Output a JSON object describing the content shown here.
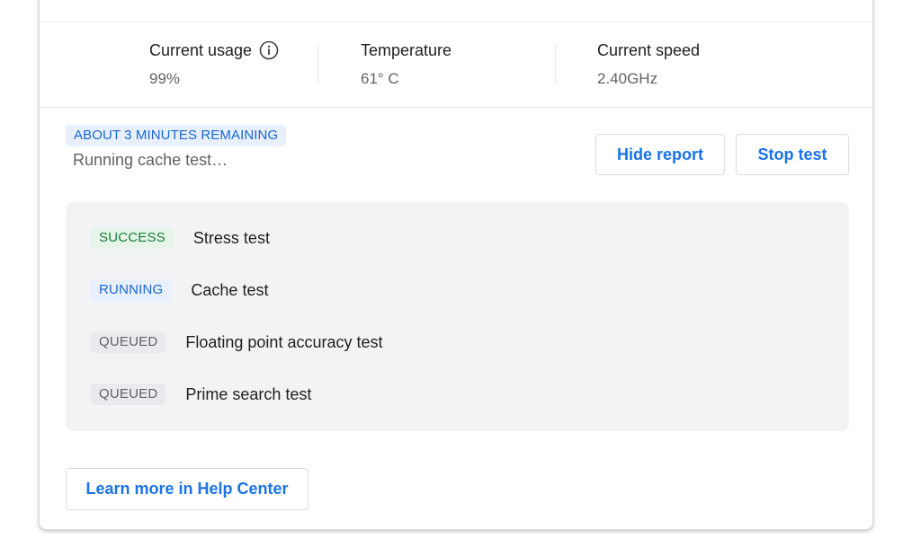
{
  "stats": [
    {
      "label": "Current usage",
      "value": "99%"
    },
    {
      "label": "Temperature",
      "value": "61° C"
    },
    {
      "label": "Current speed",
      "value": "2.40GHz"
    }
  ],
  "status": {
    "remaining": "ABOUT 3 MINUTES REMAINING",
    "message": "Running cache test…"
  },
  "buttons": {
    "hide_report": "Hide report",
    "stop_test": "Stop test",
    "learn_more": "Learn more in Help Center"
  },
  "tests": [
    {
      "status": "SUCCESS",
      "name": "Stress test"
    },
    {
      "status": "RUNNING",
      "name": "Cache test"
    },
    {
      "status": "QUEUED",
      "name": "Floating point accuracy test"
    },
    {
      "status": "QUEUED",
      "name": "Prime search test"
    }
  ],
  "colors": {
    "accent": "#1a73e8",
    "success_bg": "#e6f4ea",
    "success_fg": "#188038",
    "running_bg": "#e8f0fe",
    "running_fg": "#1967d2",
    "queued_bg": "#e8eaed",
    "queued_fg": "#5f6368",
    "panel_bg": "#f1f3f4"
  }
}
